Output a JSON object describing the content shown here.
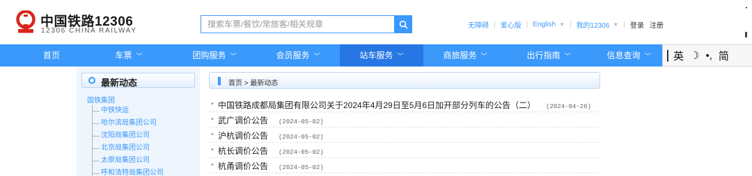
{
  "header": {
    "logo_cn": "中国铁路12306",
    "logo_en": "12306 CHINA RAILWAY",
    "search_placeholder": "搜索车票/餐饮/常旅客/相关规章",
    "top_links": {
      "accessibility": "无障碍",
      "caring_version": "爱心版",
      "english": "English",
      "my12306": "我的12306",
      "login": "登录",
      "register": "注册"
    }
  },
  "nav": {
    "items": [
      {
        "label": "首页",
        "has_dropdown": false,
        "active": false
      },
      {
        "label": "车票",
        "has_dropdown": true,
        "active": false
      },
      {
        "label": "团购服务",
        "has_dropdown": true,
        "active": false
      },
      {
        "label": "会员服务",
        "has_dropdown": true,
        "active": false
      },
      {
        "label": "站车服务",
        "has_dropdown": true,
        "active": true
      },
      {
        "label": "商旅服务",
        "has_dropdown": true,
        "active": false
      },
      {
        "label": "出行指南",
        "has_dropdown": true,
        "active": false
      },
      {
        "label": "信息查询",
        "has_dropdown": true,
        "active": false
      }
    ]
  },
  "ime_toolbar": {
    "glyphs": [
      "英",
      "☽",
      "•,",
      "简"
    ]
  },
  "sidebar": {
    "title": "最新动态",
    "group": "国铁集团",
    "items": [
      "中铁快运",
      "哈尔滨局集团公司",
      "沈阳局集团公司",
      "北京局集团公司",
      "太原局集团公司",
      "呼和浩特局集团公司"
    ]
  },
  "breadcrumb": {
    "home": "首页",
    "separator": ">",
    "current": "最新动态"
  },
  "news": [
    {
      "title": "中国铁路成都局集团有限公司关于2024年4月29日至5月6日加开部分列车的公告（二）",
      "date": "(2024-04-26)"
    },
    {
      "title": "武广调价公告",
      "date": "(2024-05-02)"
    },
    {
      "title": "沪杭调价公告",
      "date": "(2024-05-02)"
    },
    {
      "title": "杭长调价公告",
      "date": "(2024-05-02)"
    },
    {
      "title": "杭甬调价公告",
      "date": "(2024-05-02)"
    }
  ],
  "colors": {
    "brand_blue": "#3b99fc",
    "nav_active": "#2676e3",
    "logo_red": "#d7261a",
    "sidebar_bg": "#eef5fd"
  }
}
